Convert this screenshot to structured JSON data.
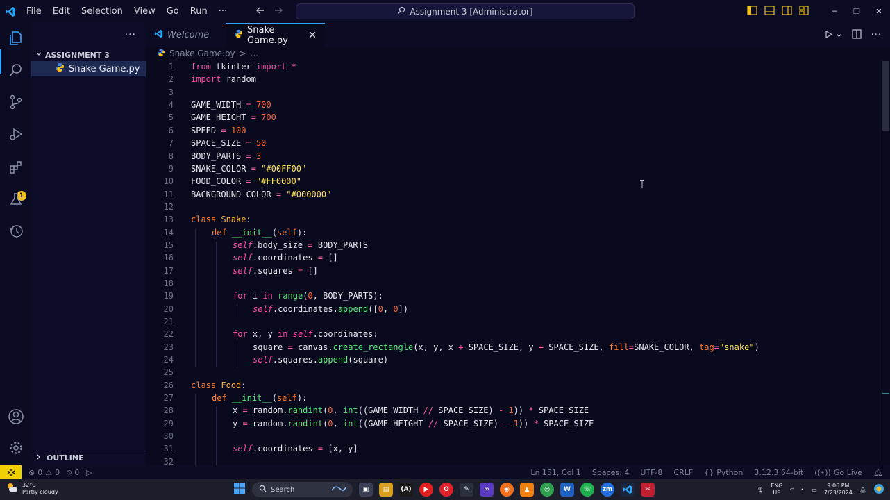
{
  "menu": [
    "File",
    "Edit",
    "Selection",
    "View",
    "Go",
    "Run",
    "···"
  ],
  "command_center": "Assignment 3 [Administrator]",
  "sidebar": {
    "more": "···",
    "folder": "ASSIGNMENT 3",
    "file": "Snake Game.py",
    "outline": "OUTLINE",
    "extensions_badge": "1"
  },
  "tabs": [
    {
      "label": "Welcome"
    },
    {
      "label": "Snake Game.py"
    }
  ],
  "tab_close": "✕",
  "breadcrumb": {
    "file": "Snake Game.py",
    "sep": ">",
    "rest": "..."
  },
  "status": {
    "errors": "0",
    "warnings": "0",
    "ports": "0",
    "position": "Ln 151, Col 1",
    "spaces": "Spaces: 4",
    "encoding": "UTF-8",
    "eol": "CRLF",
    "language": "Python",
    "interpreter": "3.12.3 64-bit",
    "golive": "Go Live"
  },
  "taskbar": {
    "temp": "32°C",
    "weather": "Partly cloudy",
    "search": "Search",
    "lang1": "ENG",
    "lang2": "US",
    "time": "9:06 PM",
    "date": "7/23/2024"
  },
  "code_lines": [
    "1",
    "2",
    "3",
    "4",
    "5",
    "6",
    "7",
    "8",
    "9",
    "10",
    "11",
    "12",
    "13",
    "14",
    "15",
    "16",
    "17",
    "18",
    "19",
    "20",
    "21",
    "22",
    "23",
    "24",
    "25",
    "26",
    "27",
    "28",
    "29",
    "30",
    "31",
    "32"
  ],
  "code": {
    "l1": [
      "from",
      " tkinter ",
      "import",
      " *"
    ],
    "l2": [
      "import",
      " random"
    ],
    "l4": [
      "GAME_WIDTH ",
      "=",
      " ",
      "700"
    ],
    "l5": [
      "GAME_HEIGHT ",
      "=",
      " ",
      "700"
    ],
    "l6": [
      "SPEED ",
      "=",
      " ",
      "100"
    ],
    "l7": [
      "SPACE_SIZE ",
      "=",
      " ",
      "50"
    ],
    "l8": [
      "BODY_PARTS ",
      "=",
      " ",
      "3"
    ],
    "l9": [
      "SNAKE_COLOR ",
      "=",
      " ",
      "\"#00FF00\""
    ],
    "l10": [
      "FOOD_COLOR ",
      "=",
      " ",
      "\"#FF0000\""
    ],
    "l11": [
      "BACKGROUND_COLOR ",
      "=",
      " ",
      "\"#000000\""
    ],
    "l13": [
      "class",
      " ",
      "Snake",
      ":"
    ],
    "l14": [
      "def",
      " ",
      "__init__",
      "(",
      "self",
      "):"
    ],
    "l15": [
      "self",
      ".body_size ",
      "=",
      " BODY_PARTS"
    ],
    "l16": [
      "self",
      ".coordinates ",
      "=",
      " []"
    ],
    "l17": [
      "self",
      ".squares ",
      "=",
      " []"
    ],
    "l19": [
      "for",
      " i ",
      "in",
      " ",
      "range",
      "(",
      "0",
      ", BODY_PARTS):"
    ],
    "l20": [
      "self",
      ".coordinates.",
      "append",
      "([",
      "0",
      ", ",
      "0",
      "])"
    ],
    "l22": [
      "for",
      " x, y ",
      "in",
      " ",
      "self",
      ".coordinates:"
    ],
    "l23": [
      "square ",
      "=",
      " canvas.",
      "create_rectangle",
      "(x, y, x ",
      "+",
      " SPACE_SIZE, y ",
      "+",
      " SPACE_SIZE, ",
      "fill",
      "=",
      "SNAKE_COLOR, ",
      "tag",
      "=",
      "\"snake\"",
      ")"
    ],
    "l24": [
      "self",
      ".squares.",
      "append",
      "(square)"
    ],
    "l26": [
      "class",
      " ",
      "Food",
      ":"
    ],
    "l27": [
      "def",
      " ",
      "__init__",
      "(",
      "self",
      "):"
    ],
    "l28": [
      "x ",
      "=",
      " random.",
      "randint",
      "(",
      "0",
      ", ",
      "int",
      "((GAME_WIDTH ",
      "//",
      " SPACE_SIZE) ",
      "-",
      " ",
      "1",
      ")) ",
      "*",
      " SPACE_SIZE"
    ],
    "l29": [
      "y ",
      "=",
      " random.",
      "randint",
      "(",
      "0",
      ", ",
      "int",
      "((GAME_HEIGHT ",
      "//",
      " SPACE_SIZE) ",
      "-",
      " ",
      "1",
      ")) ",
      "*",
      " SPACE_SIZE"
    ],
    "l31": [
      "self",
      ".coordinates ",
      "=",
      " [x, y]"
    ]
  },
  "colors": {
    "accent": "#3fa3ff",
    "keyword": "#ff4aa8",
    "string": "#ffe45a",
    "number": "#ff6b3a",
    "function": "#5ee87a",
    "class": "#ffb040",
    "remote": "#f0d000"
  }
}
